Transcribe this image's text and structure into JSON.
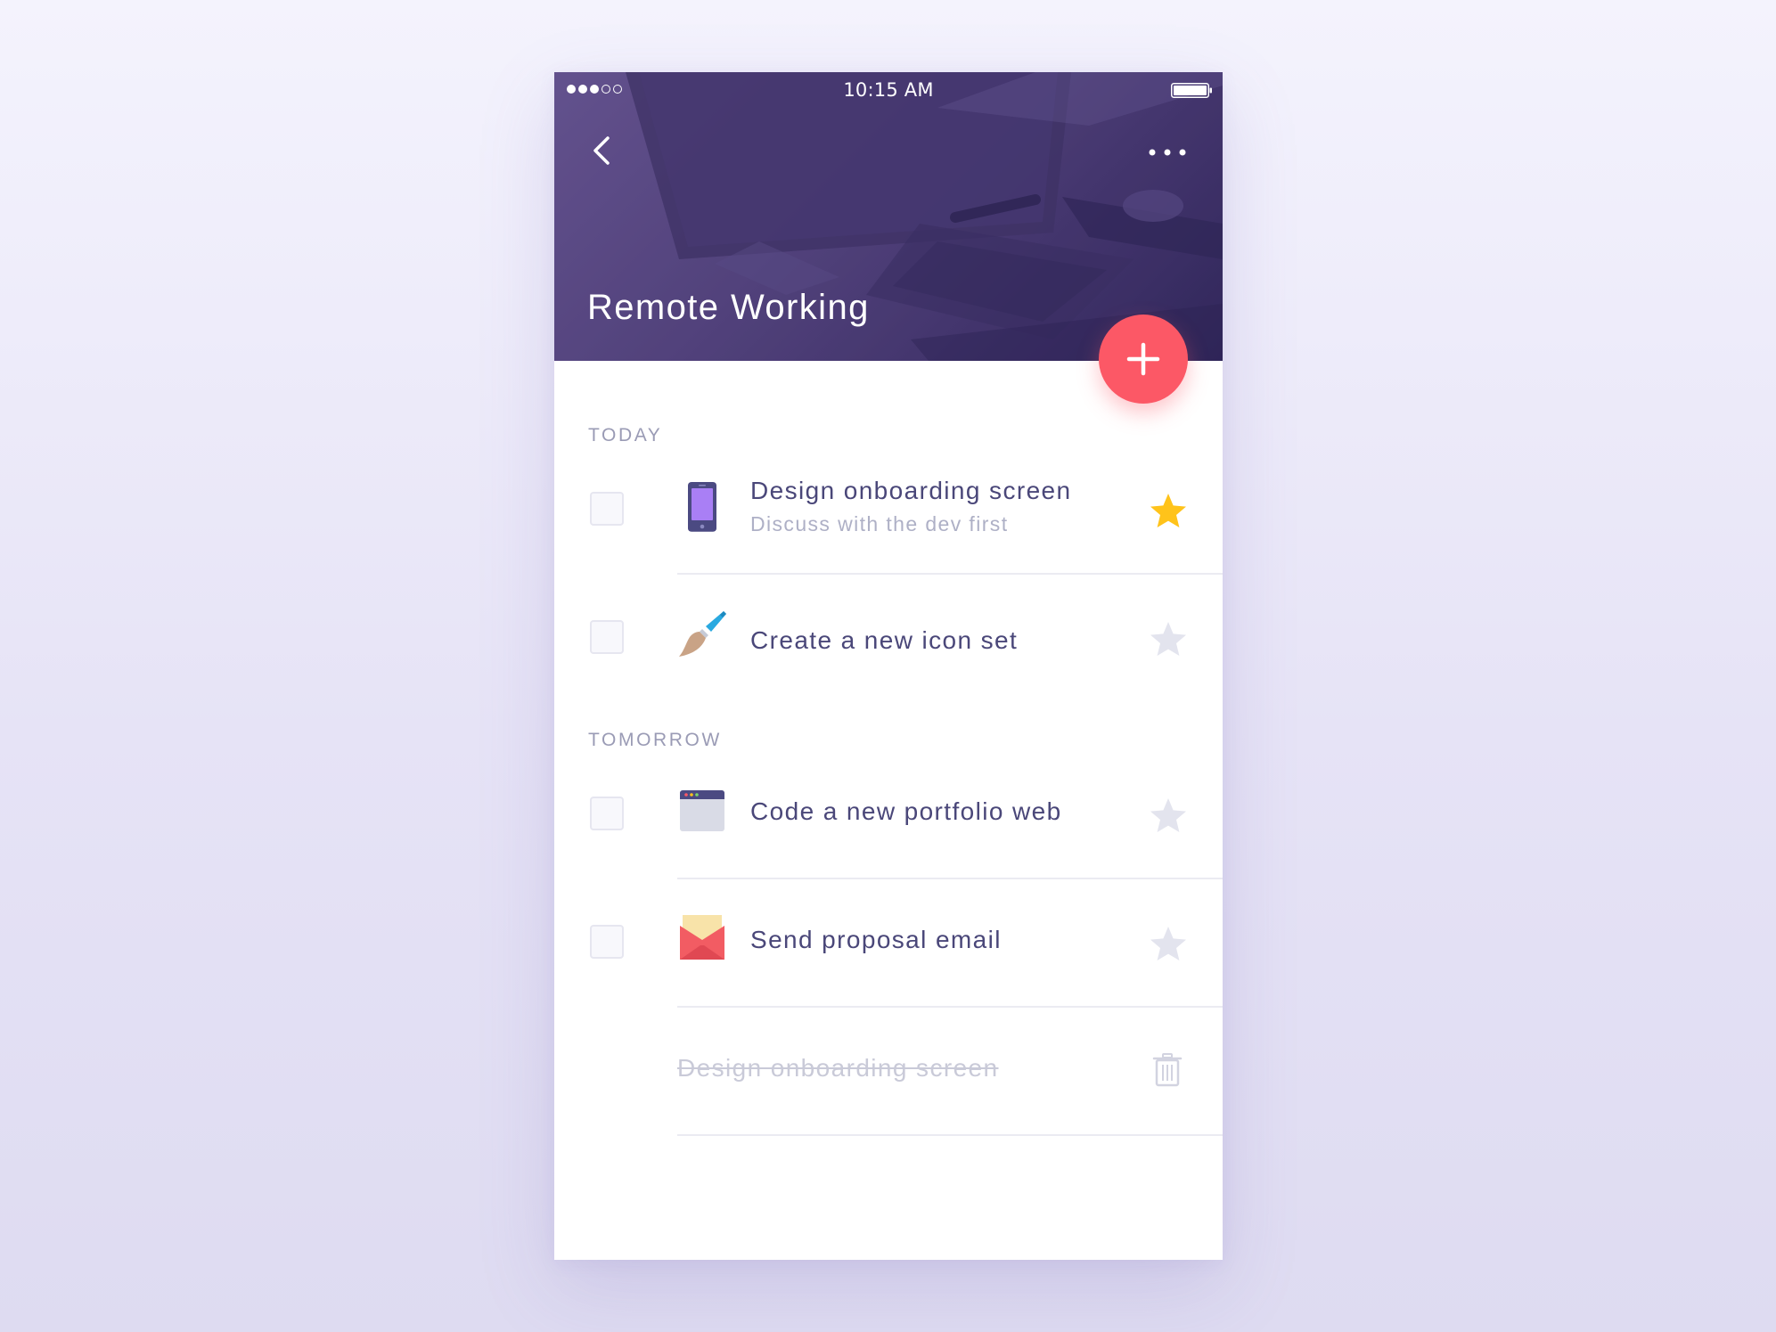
{
  "status_bar": {
    "time": "10:15 AM",
    "signal_bars_filled": 3,
    "signal_bars_total": 5,
    "battery": "full"
  },
  "header": {
    "title": "Remote Working",
    "back_icon": "chevron-left-icon",
    "more_icon": "more-horizontal-icon",
    "add_icon": "plus-icon"
  },
  "sections": [
    {
      "label": "TODAY",
      "tasks": [
        {
          "title": "Design onboarding screen",
          "subtitle": "Discuss with the dev first",
          "icon": "phone-icon",
          "starred": true,
          "checked": false
        },
        {
          "title": "Create a new icon set",
          "icon": "paintbrush-icon",
          "starred": false,
          "checked": false
        }
      ]
    },
    {
      "label": "TOMORROW",
      "tasks": [
        {
          "title": "Code a new portfolio web",
          "icon": "browser-window-icon",
          "starred": false,
          "checked": false
        },
        {
          "title": "Send proposal email",
          "icon": "envelope-icon",
          "starred": false,
          "checked": false
        }
      ]
    }
  ],
  "completed": [
    {
      "title": "Design onboarding screen",
      "icon": "trash-icon"
    }
  ],
  "colors": {
    "accent": "#fc5866",
    "star_active": "#ffc31a",
    "star_inactive": "#e3e4ee",
    "text_primary": "#4a4779",
    "text_secondary": "#aeb0c6",
    "section_label": "#9a9bb5",
    "header_bg": "#54447e"
  }
}
